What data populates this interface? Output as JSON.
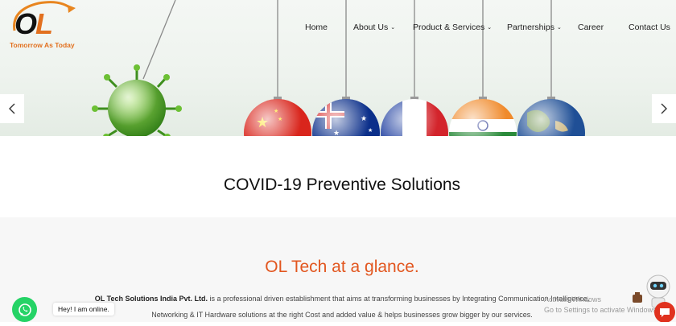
{
  "brand": {
    "logo_text": "OL",
    "tagline": "Tomorrow As Today"
  },
  "nav": {
    "items": [
      {
        "label": "Home",
        "has_dropdown": false
      },
      {
        "label": "About Us",
        "has_dropdown": true
      },
      {
        "label": "Product & Services",
        "has_dropdown": true
      },
      {
        "label": "Partnerships",
        "has_dropdown": true
      },
      {
        "label": "Career",
        "has_dropdown": false
      },
      {
        "label": "Contact Us",
        "has_dropdown": false
      }
    ],
    "chevron": "⌄"
  },
  "slider": {
    "prev_icon": "chevron-left-icon",
    "next_icon": "chevron-right-icon"
  },
  "sections": {
    "covid_title": "COVID-19 Preventive Solutions",
    "glance_title": "OL Tech at a glance.",
    "about": {
      "company": "OL Tech Solutions India Pvt. Ltd.",
      "line1_rest": " is a professional driven establishment that aims at transforming businesses by Integrating Communication Intelligence,",
      "line2": "Networking & IT Hardware solutions at the right Cost and added value & helps businesses grow bigger by our services."
    }
  },
  "whatsapp": {
    "bubble_text": "Hey! I am online."
  },
  "windows_watermark": {
    "line1": "Activate Windows",
    "line2": "Go to Settings to activate Windows."
  },
  "colors": {
    "accent_orange": "#e2561f",
    "logo_orange": "#e2701f",
    "whatsapp_green": "#25d366",
    "virus_green": "#5fae2a"
  }
}
